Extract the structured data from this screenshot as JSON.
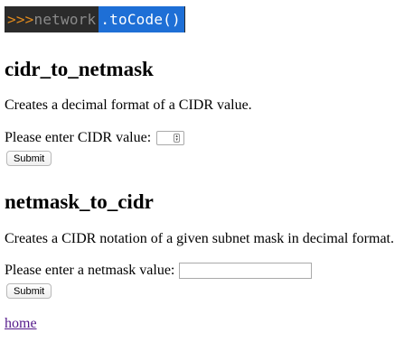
{
  "logo": {
    "prompt": ">>>",
    "word": "network",
    "suffix": ".toCode()"
  },
  "section1": {
    "title": "cidr_to_netmask",
    "description": "Creates a decimal format of a CIDR value.",
    "label": "Please enter CIDR value:",
    "submit_label": "Submit"
  },
  "section2": {
    "title": "netmask_to_cidr",
    "description": "Creates a CIDR notation of a given subnet mask in decimal format.",
    "label": "Please enter a netmask value:",
    "submit_label": "Submit"
  },
  "footer": {
    "home_link": "home"
  }
}
